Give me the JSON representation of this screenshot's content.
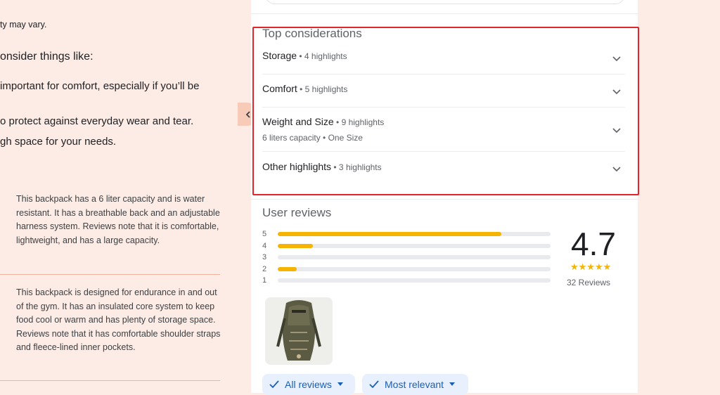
{
  "left": {
    "line1": "ty may vary.",
    "line2": "onsider things like:",
    "line3": "important for comfort, especially if you’ll be",
    "line4": "o protect against everyday wear and tear.",
    "line5": "gh space for your needs.",
    "card1": "This backpack has a 6 liter capacity and is water resistant. It has a breathable back and an adjustable harness system. Reviews note that it is comfortable, lightweight, and has a large capacity.",
    "card2": "This backpack is designed for endurance in and out of the gym. It has an insulated core system to keep food cool or warm and has plenty of storage space. Reviews note that it has comfortable shoulder straps and fleece-lined inner pockets."
  },
  "considerations": {
    "title": "Top considerations",
    "items": [
      {
        "label": "Storage",
        "count": " • 4 highlights",
        "sub": ""
      },
      {
        "label": "Comfort",
        "count": " • 5 highlights",
        "sub": ""
      },
      {
        "label": "Weight and Size",
        "count": " • 9 highlights",
        "sub": "6 liters capacity • One Size"
      },
      {
        "label": "Other highlights",
        "count": " • 3 highlights",
        "sub": ""
      }
    ]
  },
  "reviews": {
    "title": "User reviews",
    "rating": "4.7",
    "stars": "★★★★★",
    "count_label": "32 Reviews",
    "distribution": [
      {
        "star": "5",
        "fraction": 0.82
      },
      {
        "star": "4",
        "fraction": 0.13
      },
      {
        "star": "3",
        "fraction": 0.0
      },
      {
        "star": "2",
        "fraction": 0.07
      },
      {
        "star": "1",
        "fraction": 0.0
      }
    ],
    "filters": [
      {
        "label": "All reviews"
      },
      {
        "label": "Most relevant"
      }
    ]
  },
  "colors": {
    "accent": "#f4b400",
    "chip_bg": "#e8f0fe",
    "chip_text": "#1a5fb4",
    "highlight_border": "#e4232a",
    "page_bg": "#fdece5"
  }
}
